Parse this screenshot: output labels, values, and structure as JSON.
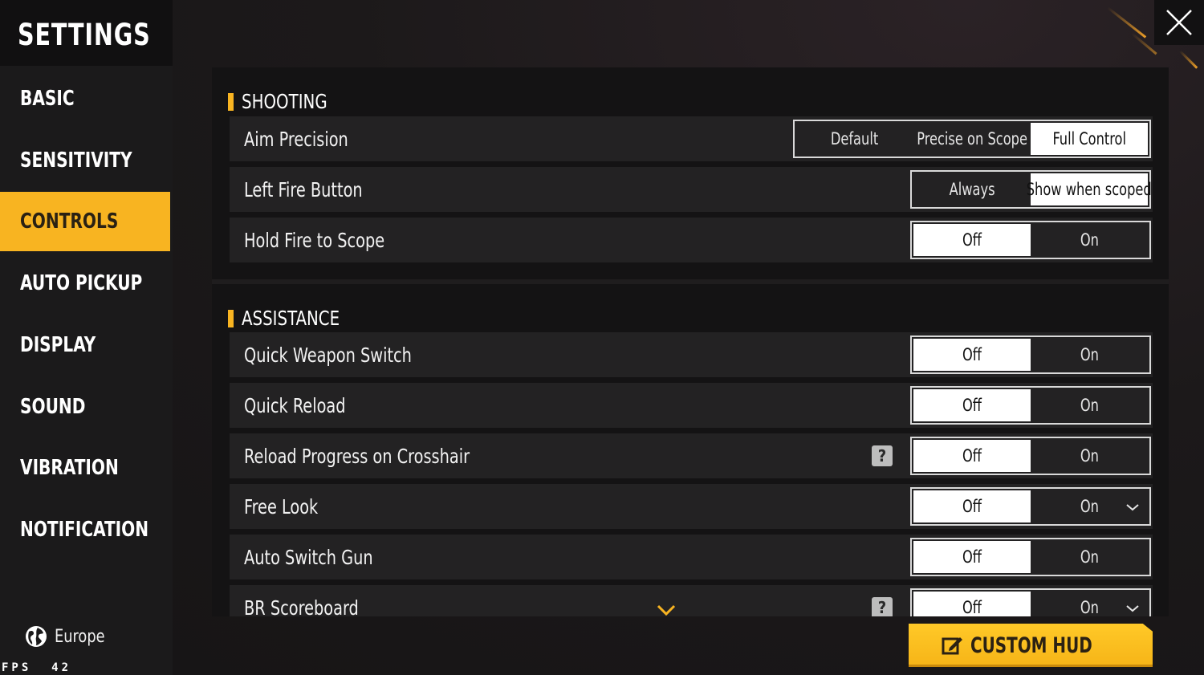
{
  "title": "SETTINGS",
  "nav": [
    {
      "label": "BASIC",
      "active": false
    },
    {
      "label": "SENSITIVITY",
      "active": false
    },
    {
      "label": "CONTROLS",
      "active": true
    },
    {
      "label": "AUTO PICKUP",
      "active": false
    },
    {
      "label": "DISPLAY",
      "active": false
    },
    {
      "label": "SOUND",
      "active": false
    },
    {
      "label": "VIBRATION",
      "active": false
    },
    {
      "label": "NOTIFICATION",
      "active": false
    }
  ],
  "region": {
    "label": "Europe",
    "icon": "globe-icon"
  },
  "fps": {
    "label": "FPS",
    "value": "42"
  },
  "close_icon": "close-icon",
  "sections": [
    {
      "title": "SHOOTING",
      "rows": [
        {
          "label": "Aim Precision",
          "options": [
            "Default",
            "Precise on Scope",
            "Full Control"
          ],
          "selected": 2
        },
        {
          "label": "Left Fire Button",
          "options": [
            "Always",
            "Show when scoped"
          ],
          "selected": 1
        },
        {
          "label": "Hold Fire to Scope",
          "options": [
            "Off",
            "On"
          ],
          "selected": 0
        }
      ]
    },
    {
      "title": "ASSISTANCE",
      "rows": [
        {
          "label": "Quick Weapon Switch",
          "options": [
            "Off",
            "On"
          ],
          "selected": 0
        },
        {
          "label": "Quick Reload",
          "options": [
            "Off",
            "On"
          ],
          "selected": 0
        },
        {
          "label": "Reload Progress on Crosshair",
          "options": [
            "Off",
            "On"
          ],
          "selected": 0,
          "help": "?"
        },
        {
          "label": "Free Look",
          "options": [
            "Off",
            "On"
          ],
          "selected": 0,
          "expand": true
        },
        {
          "label": "Auto Switch Gun",
          "options": [
            "Off",
            "On"
          ],
          "selected": 0
        },
        {
          "label": "BR Scoreboard",
          "options": [
            "Off",
            "On"
          ],
          "selected": 0,
          "help": "?",
          "expand": true
        }
      ]
    }
  ],
  "custom_hud": {
    "label": "CUSTOM HUD",
    "icon": "edit-icon"
  },
  "colors": {
    "accent": "#f8b421",
    "panel": "#141314",
    "row": "#232223"
  }
}
